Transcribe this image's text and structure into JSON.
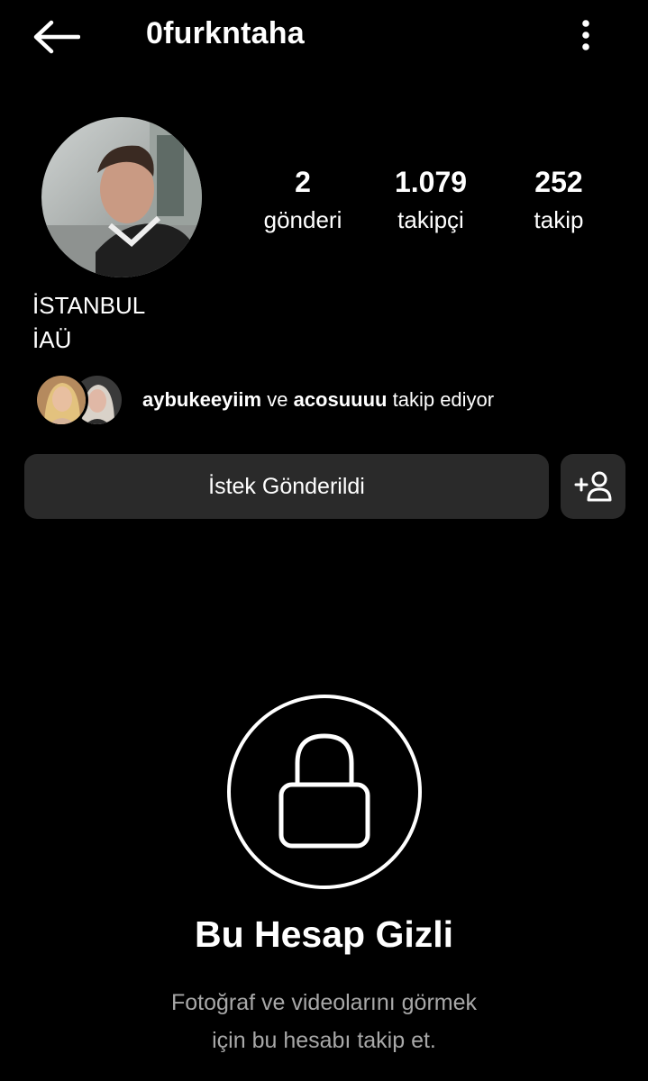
{
  "header": {
    "back_icon": "arrow-left-icon",
    "username": "0furkntaha",
    "more_icon": "more-vertical-icon"
  },
  "profile": {
    "avatar_icon": "profile-photo",
    "stats": [
      {
        "value": "2",
        "label": "gönderi"
      },
      {
        "value": "1.079",
        "label": "takipçi"
      },
      {
        "value": "252",
        "label": "takip"
      }
    ],
    "bio": [
      "İSTANBUL",
      "İAÜ"
    ]
  },
  "followed_by": {
    "user1": "aybukeeyiim",
    "connector": "ve",
    "user2": "acosuuuu",
    "suffix": "takip ediyor"
  },
  "actions": {
    "request_label": "İstek Gönderildi",
    "add_user_icon": "add-person-icon"
  },
  "private_notice": {
    "icon": "lock-icon",
    "title": "Bu Hesap Gizli",
    "line1": "Fotoğraf ve videolarını görmek",
    "line2": "için bu hesabı takip et."
  },
  "colors": {
    "background": "#000000",
    "button_bg": "#2a2a2a",
    "text": "#ffffff",
    "muted_text": "#a8a8a8"
  }
}
